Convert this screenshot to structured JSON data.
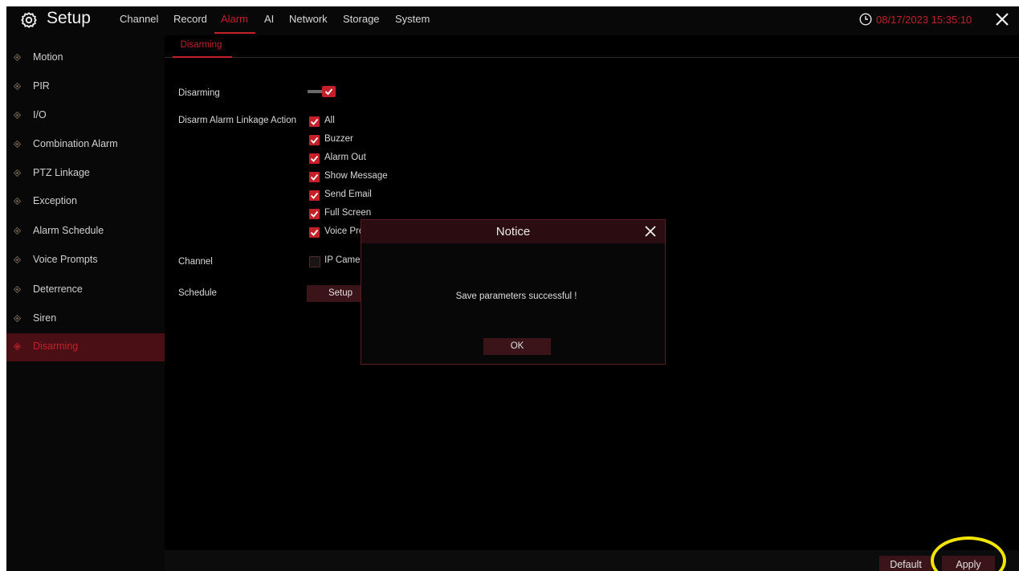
{
  "header": {
    "title": "Setup",
    "tabs": [
      {
        "label": "Channel",
        "active": false
      },
      {
        "label": "Record",
        "active": false
      },
      {
        "label": "Alarm",
        "active": true
      },
      {
        "label": "AI",
        "active": false
      },
      {
        "label": "Network",
        "active": false
      },
      {
        "label": "Storage",
        "active": false
      },
      {
        "label": "System",
        "active": false
      }
    ],
    "datetime": "08/17/2023 15:35:10",
    "close_icon": "close-icon"
  },
  "sidebar": {
    "items": [
      {
        "label": "Motion"
      },
      {
        "label": "PIR"
      },
      {
        "label": "I/O"
      },
      {
        "label": "Combination Alarm"
      },
      {
        "label": "PTZ Linkage"
      },
      {
        "label": "Exception"
      },
      {
        "label": "Alarm Schedule"
      },
      {
        "label": "Voice Prompts"
      },
      {
        "label": "Deterrence"
      },
      {
        "label": "Siren"
      },
      {
        "label": "Disarming",
        "active": true
      }
    ]
  },
  "main": {
    "subtab": "Disarming",
    "disarming_label": "Disarming",
    "disarming_enabled": true,
    "linkage_label": "Disarm Alarm Linkage Action",
    "linkage_options": [
      {
        "label": "All",
        "checked": true
      },
      {
        "label": "Buzzer",
        "checked": true
      },
      {
        "label": "Alarm Out",
        "checked": true
      },
      {
        "label": "Show Message",
        "checked": true
      },
      {
        "label": "Send Email",
        "checked": true
      },
      {
        "label": "Full Screen",
        "checked": true
      },
      {
        "label": "Voice Pror",
        "checked": true
      }
    ],
    "channel_label": "Channel",
    "channel_option": {
      "label": "IP Camera",
      "checked": false
    },
    "schedule_label": "Schedule",
    "schedule_button": "Setup"
  },
  "footer": {
    "default_button": "Default",
    "apply_button": "Apply"
  },
  "dialog": {
    "title": "Notice",
    "message": "Save parameters successful !",
    "ok_button": "OK"
  },
  "colors": {
    "accent": "#c3202a",
    "highlight": "#f2e600"
  }
}
